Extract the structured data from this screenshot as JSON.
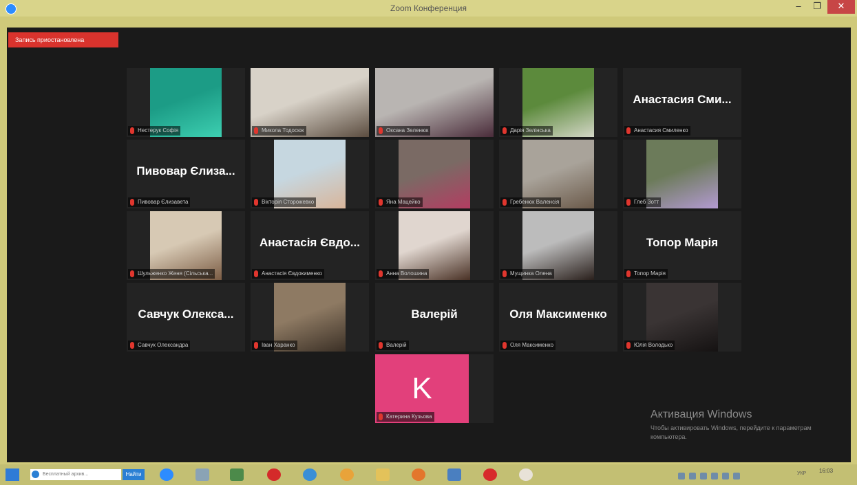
{
  "window": {
    "title": "Zoom Конференция",
    "minimize": "–",
    "maximize": "❐",
    "close": "✕"
  },
  "recording_badge": "Запись приостановлена",
  "tiles": [
    {
      "label": "Нестерук Софія",
      "bigname": "",
      "type": "video",
      "colors": [
        "#1c9c86",
        "#3dcfb1"
      ]
    },
    {
      "label": "Микола Тодосюк",
      "bigname": "",
      "type": "video",
      "colors": [
        "#d8d2c8",
        "#5a4b3e"
      ],
      "active": true
    },
    {
      "label": "Оксана Зеленюк",
      "bigname": "",
      "type": "video",
      "colors": [
        "#b9b5b2",
        "#4a2c3a"
      ]
    },
    {
      "label": "Дарія Зелінська",
      "bigname": "",
      "type": "video",
      "colors": [
        "#5c8a3c",
        "#d3d6c6"
      ]
    },
    {
      "label": "Анастасия Смиленко",
      "bigname": "Анастасия Сми...",
      "type": "name"
    },
    {
      "label": "Пивовар Єлизавета",
      "bigname": "Пивовар Єлиза...",
      "type": "name"
    },
    {
      "label": "Вікторія Сторожевко",
      "bigname": "",
      "type": "video",
      "colors": [
        "#c6d7e0",
        "#d8b59a"
      ]
    },
    {
      "label": "Яна Мацейко",
      "bigname": "",
      "type": "video",
      "colors": [
        "#7a6a64",
        "#b33d62"
      ]
    },
    {
      "label": "Гребенюк Валенсія",
      "bigname": "",
      "type": "video",
      "colors": [
        "#a9a39a",
        "#6b5a4a"
      ]
    },
    {
      "label": "Глеб Зотт",
      "bigname": "",
      "type": "video",
      "colors": [
        "#6c7b5a",
        "#b39ad2"
      ]
    },
    {
      "label": "Шульженко Женя (Сільська...",
      "bigname": "",
      "type": "video",
      "colors": [
        "#d7c9b4",
        "#7b5c44"
      ]
    },
    {
      "label": "Анастасія Євдокименко",
      "bigname": "Анастасія Євдо...",
      "type": "name"
    },
    {
      "label": "Анна Волошина",
      "bigname": "",
      "type": "video",
      "colors": [
        "#e0d6cf",
        "#4a3226"
      ]
    },
    {
      "label": "Мущинка Олена",
      "bigname": "",
      "type": "video",
      "colors": [
        "#bcbcbc",
        "#2a201c"
      ]
    },
    {
      "label": "Топор Марія",
      "bigname": "Топор Марія",
      "type": "name"
    },
    {
      "label": "Савчук Олександра",
      "bigname": "Савчук Олекса...",
      "type": "name"
    },
    {
      "label": "Іван Харанко",
      "bigname": "",
      "type": "video",
      "colors": [
        "#8e7a63",
        "#3b3026"
      ]
    },
    {
      "label": "Валерій",
      "bigname": "Валерій",
      "type": "name"
    },
    {
      "label": "Оля Максименко",
      "bigname": "Оля Максименко",
      "type": "name"
    },
    {
      "label": "Юлія Володько",
      "bigname": "",
      "type": "video",
      "colors": [
        "#3a3434",
        "#151212"
      ]
    },
    {
      "label": "Катерина Кузьова",
      "bigname": "",
      "type": "avatar",
      "initial": "K"
    }
  ],
  "watermark": {
    "title": "Активация Windows",
    "text": "Чтобы активировать Windows, перейдите к параметрам компьютера."
  },
  "taskbar": {
    "search_placeholder": "Бесплатный архив...",
    "search_button": "Найти",
    "lang": "УКР",
    "time": "16:03"
  }
}
